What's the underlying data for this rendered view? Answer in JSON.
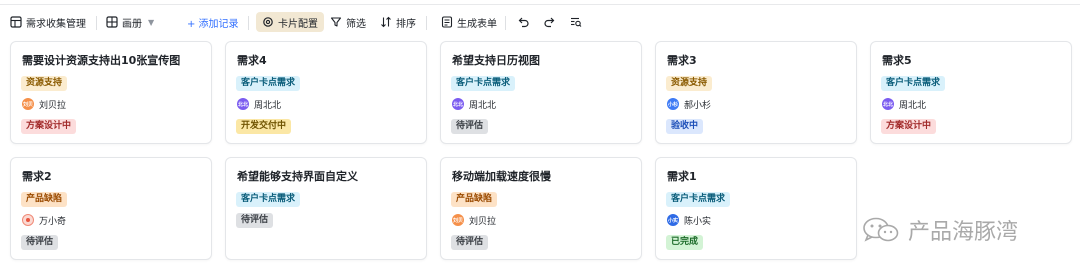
{
  "toolbar": {
    "view_name": "需求收集管理",
    "layout_label": "画册",
    "add_record": "+ 添加记录",
    "card_config": "卡片配置",
    "filter": "筛选",
    "sort": "排序",
    "gen_form": "生成表单"
  },
  "colors": {
    "accent": "#3370ff",
    "tag_yellow_bg": "#fbeccf",
    "tag_cyan_bg": "#d9f1fb",
    "tag_orange_bg": "#fde2c6",
    "status_gray_bg": "#dee0e3",
    "status_yellow_bg": "#fbe7a5",
    "status_pink_bg": "#fcdcdc",
    "status_blue_bg": "#dbe7fd",
    "status_green_bg": "#d3f3d5"
  },
  "cards": [
    {
      "title": "需要设计资源支持出10张宣传图",
      "tag": "资源支持",
      "person": "刘贝拉",
      "avatar": "刘贝",
      "status": "方案设计中"
    },
    {
      "title": "需求4",
      "tag": "客户卡点需求",
      "person": "周北北",
      "avatar": "北北",
      "status": "开发交付中"
    },
    {
      "title": "希望支持日历视图",
      "tag": "客户卡点需求",
      "person": "周北北",
      "avatar": "北北",
      "status": "待评估"
    },
    {
      "title": "需求3",
      "tag": "资源支持",
      "person": "郝小杉",
      "avatar": "小杉",
      "status": "验收中"
    },
    {
      "title": "需求5",
      "tag": "客户卡点需求",
      "person": "周北北",
      "avatar": "北北",
      "status": "方案设计中"
    },
    {
      "title": "需求2",
      "tag": "产品缺陷",
      "person": "万小奇",
      "avatar": "",
      "status": "待评估"
    },
    {
      "title": "希望能够支持界面自定义",
      "tag": "客户卡点需求",
      "person": "",
      "avatar": "",
      "status": "待评估"
    },
    {
      "title": "移动端加载速度很慢",
      "tag": "产品缺陷",
      "person": "刘贝拉",
      "avatar": "刘贝",
      "status": "待评估"
    },
    {
      "title": "需求1",
      "tag": "客户卡点需求",
      "person": "陈小实",
      "avatar": "小实",
      "status": "已完成"
    }
  ],
  "watermark": "产品海豚湾"
}
